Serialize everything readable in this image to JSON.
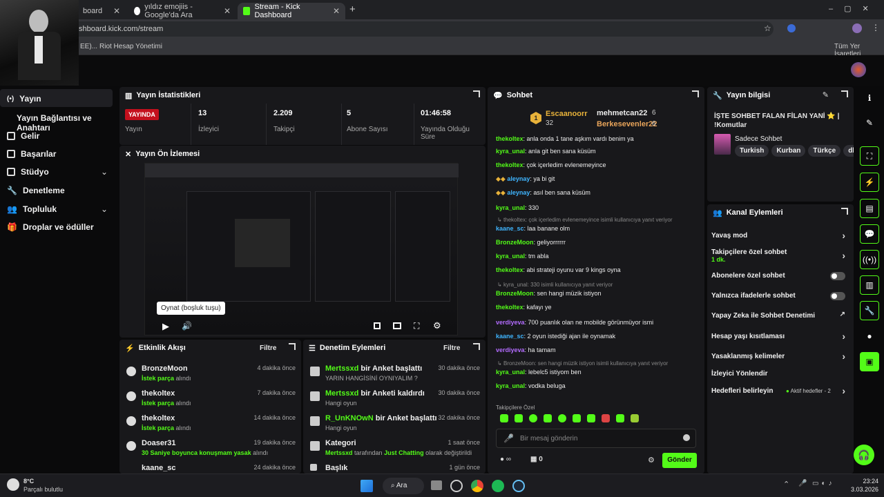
{
  "browser": {
    "tabs": [
      {
        "label": "board"
      },
      {
        "label": "yıldız emojiis - Google'da Ara"
      },
      {
        "label": "Stream - Kick Dashboard"
      }
    ],
    "new_tab": "+",
    "url": "shboard.kick.com/stream",
    "bookmarks": {
      "item1": "EE)...",
      "item2": "Riot Hesap Yönetimi",
      "all": "Tüm Yer İşaretleri"
    }
  },
  "sidebar": {
    "items": [
      {
        "label": "Yayın"
      },
      {
        "label": "Yayın Bağlantısı ve Anahtarı"
      },
      {
        "label": "Gelir"
      },
      {
        "label": "Başarılar"
      },
      {
        "label": "Stüdyo"
      },
      {
        "label": "Denetleme"
      },
      {
        "label": "Topluluk"
      },
      {
        "label": "Droplar ve ödüller"
      }
    ]
  },
  "stats": {
    "title": "Yayın İstatistikleri",
    "live_badge": "YAYINDA",
    "items": [
      {
        "value": "",
        "label": "Yayın"
      },
      {
        "value": "13",
        "label": "İzleyici"
      },
      {
        "value": "2.209",
        "label": "Takipçi"
      },
      {
        "value": "5",
        "label": "Abone Sayısı"
      },
      {
        "value": "01:46:58",
        "label": "Yayında Olduğu Süre"
      }
    ]
  },
  "preview": {
    "title": "Yayın Ön İzlemesi",
    "tooltip": "Oynat (boşluk tuşu)"
  },
  "activity": {
    "title": "Etkinlik Akışı",
    "filter": "Filtre",
    "rows": [
      {
        "name": "BronzeMoon",
        "action_hl": "İstek parça",
        "action": " alındı",
        "time": "4 dakika önce"
      },
      {
        "name": "thekoltex",
        "action_hl": "İstek parça",
        "action": " alındı",
        "time": "7 dakika önce"
      },
      {
        "name": "thekoltex",
        "action_hl": "İstek parça",
        "action": " alındı",
        "time": "14 dakika önce"
      },
      {
        "name": "Doaser31",
        "action_hl": "30 Saniye boyunca konuşmam yasak",
        "action": " alındı",
        "time": "19 dakika önce"
      },
      {
        "name": "kaane_sc",
        "action_hl": "",
        "action": "",
        "time": "24 dakika önce"
      }
    ]
  },
  "moderation": {
    "title": "Denetim Eylemleri",
    "filter": "Filtre",
    "rows": [
      {
        "user": "Mertssxd",
        "action": " bir Anket başlattı",
        "sub": "YARIN HANGİSİNİ OYNIYALIM ?",
        "time": "30 dakika önce"
      },
      {
        "user": "Mertssxd",
        "action": " bir Anketi kaldırdı",
        "sub": "Hangi oyun",
        "time": "30 dakika önce"
      },
      {
        "user": "R_UnKNOwN",
        "action": " bir Anket başlattı",
        "sub": "Hangi oyun",
        "time": "32 dakika önce"
      },
      {
        "user": "",
        "action": "Kategori",
        "sub_user": "Mertssxd",
        "sub_mid": " tarafından ",
        "sub_cat": "Just Chatting",
        "sub_end": " olarak değiştirildi",
        "time": "1 saat önce"
      },
      {
        "user": "",
        "action": "Başlık",
        "sub": "",
        "time": "1 gün önce"
      }
    ]
  },
  "chat": {
    "title": "Sohbet",
    "top": [
      {
        "name": "Escaanoorr",
        "count": "32",
        "rank": "1"
      },
      {
        "name": "mehmetcan22",
        "count": "6"
      },
      {
        "name": "Berkesevenler22",
        "count": "6"
      }
    ],
    "messages": [
      {
        "user": "thekoltex",
        "text": ": anla onda 1 tane aşkım vardı benim ya",
        "color": "#53fc18"
      },
      {
        "user": "kyra_unal",
        "text": ": anla git ben sana küsüm",
        "color": "#53fc18"
      },
      {
        "user": "thekoltex",
        "text": ": çok içerledim evlenemeyince",
        "color": "#53fc18"
      },
      {
        "user": "aleynay",
        "text": ": ya bi git",
        "color": "#3fb5ff"
      },
      {
        "user": "aleynay",
        "text": ": asıl ben sana küsüm",
        "color": "#3fb5ff"
      },
      {
        "user": "kyra_unal",
        "text": ": 330",
        "color": "#53fc18"
      },
      {
        "user": "kaane_sc",
        "text": ": laa banane olm",
        "color": "#3fb5ff"
      },
      {
        "user": "BronzeMoon",
        "text": ": geliyorrrrrr",
        "color": "#53fc18"
      },
      {
        "user": "kyra_unal",
        "text": ": tm abla",
        "color": "#53fc18"
      },
      {
        "user": "thekoltex",
        "text": ": abi strateji oyunu var 9 kings oyna",
        "color": "#53fc18"
      },
      {
        "user": "BronzeMoon",
        "text": ": sen hangi müzik istiyon",
        "color": "#53fc18"
      },
      {
        "user": "thekoltex",
        "text": ": kafayı ye",
        "color": "#53fc18"
      },
      {
        "user": "verdiyeva",
        "text": ": 700 puanlık olan ne mobilde görünmüyor ismi",
        "color": "#b36cff"
      },
      {
        "user": "kaane_sc",
        "text": ": 2 oyun istediği ajan ile oynamak",
        "color": "#3fb5ff"
      },
      {
        "user": "verdiyeva",
        "text": ": ha tamam",
        "color": "#b36cff"
      },
      {
        "user": "kyra_unal",
        "text": ": lebelc5 istiyom ben",
        "color": "#53fc18"
      },
      {
        "user": "kyra_unal",
        "text": ": vodka beluga",
        "color": "#53fc18"
      }
    ],
    "replies": [
      "thekoltex: çok içerledim evlenemeyince isimli kullanıcıya yanıt veriyor",
      "kyra_unal: 330 isimli kullanıcıya yanıt veriyor",
      "BronzeMoon: sen hangi müzik istiyon isimli kullanıcıya yanıt veriyor"
    ],
    "mode": "Takipçilere Özel",
    "placeholder": "Bir mesaj gönderin",
    "points": "0",
    "send": "Gönder"
  },
  "info": {
    "title": "Yayın bilgisi",
    "stream_title": "İŞTE SOHBET FALAN FİLAN YANİ ⭐ | !Komutlar",
    "category": "Sadece Sohbet",
    "tags": [
      "Turkish",
      "Kurban",
      "Türkçe",
      "db"
    ]
  },
  "actions": {
    "title": "Kanal Eylemleri",
    "items": [
      {
        "label": "Yavaş mod"
      },
      {
        "label": "Takipçilere özel sohbet",
        "sub": "1 dk."
      },
      {
        "label": "Abonelere özel sohbet"
      },
      {
        "label": "Yalnızca ifadelerle sohbet"
      },
      {
        "label": "Yapay Zeka ile Sohbet Denetimi"
      },
      {
        "label": "Hesap yaşı kısıtlaması"
      },
      {
        "label": "Yasaklanmış kelimeler"
      },
      {
        "label": "İzleyici Yönlendir"
      },
      {
        "label": "Hedefleri belirleyin",
        "sub": "Aktif hedefler - 2"
      }
    ]
  },
  "taskbar": {
    "weather_temp": "8°C",
    "weather_desc": "Parçalı bulutlu",
    "search": "Ara",
    "time": "23:24",
    "date": "3.03.2026"
  },
  "colors": {
    "accent": "#53fc18",
    "live": "#c4101d"
  }
}
